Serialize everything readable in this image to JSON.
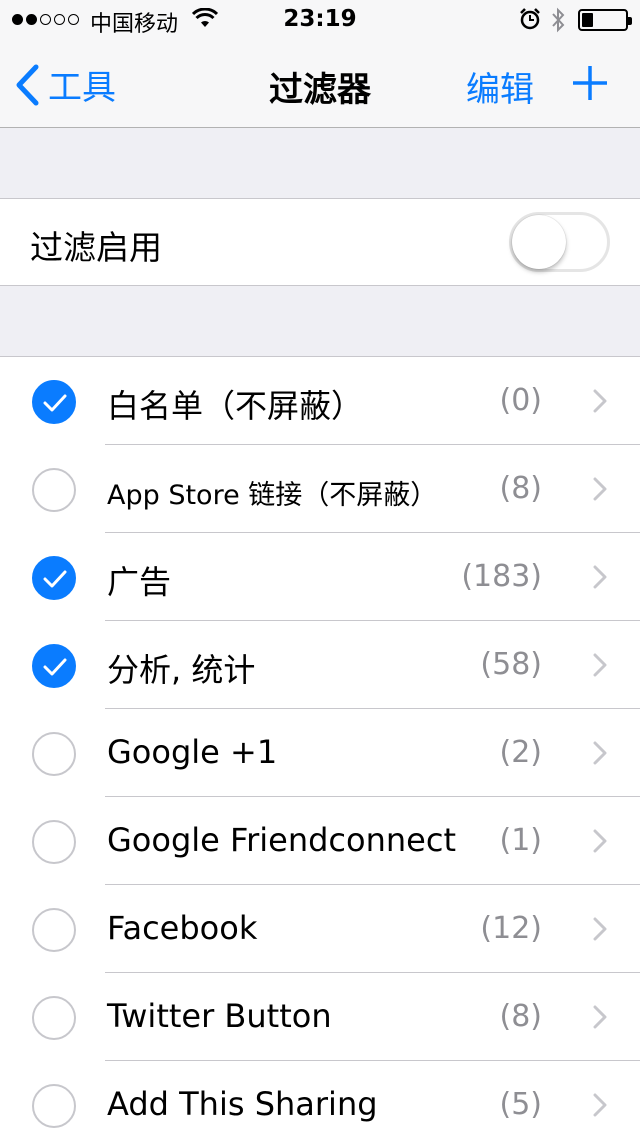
{
  "status": {
    "carrier": "中国移动",
    "time": "23:19",
    "signal_bars": 2,
    "battery_level": 0.2
  },
  "nav": {
    "back_label": "工具",
    "title": "过滤器",
    "edit_label": "编辑",
    "add_icon": "plus-icon"
  },
  "filter_toggle": {
    "label": "过滤启用",
    "enabled": false
  },
  "filters": [
    {
      "label": "白名单（不屏蔽）",
      "count": "(0)",
      "checked": true
    },
    {
      "label": "App Store 链接（不屏蔽）",
      "count": "(8)",
      "checked": false
    },
    {
      "label": "广告",
      "count": "(183)",
      "checked": true
    },
    {
      "label": "分析, 统计",
      "count": "(58)",
      "checked": true
    },
    {
      "label": "Google +1",
      "count": "(2)",
      "checked": false
    },
    {
      "label": "Google Friendconnect",
      "count": "(1)",
      "checked": false
    },
    {
      "label": "Facebook",
      "count": "(12)",
      "checked": false
    },
    {
      "label": "Twitter Button",
      "count": "(8)",
      "checked": false
    },
    {
      "label": "Add This Sharing",
      "count": "(5)",
      "checked": false
    }
  ],
  "colors": {
    "accent": "#0a7cff",
    "background": "#efeff4",
    "secondary_text": "#8e8e93"
  }
}
